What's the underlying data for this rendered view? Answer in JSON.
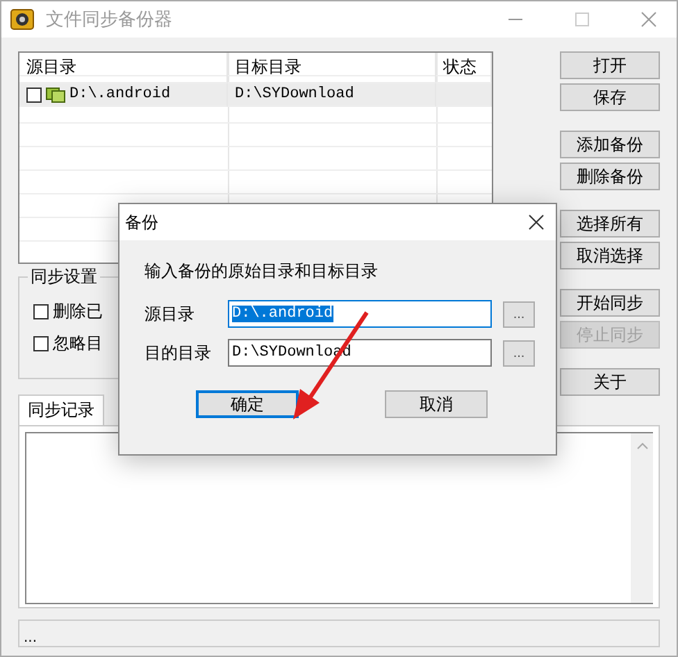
{
  "window": {
    "title": "文件同步备份器"
  },
  "list": {
    "columns": [
      "源目录",
      "目标目录",
      "状态"
    ],
    "rows": [
      {
        "checked": false,
        "selected": true,
        "cells": [
          "D:\\.android",
          "D:\\SYDownload",
          ""
        ]
      }
    ]
  },
  "button_groups": [
    [
      {
        "label": "打开",
        "disabled": false
      },
      {
        "label": "保存",
        "disabled": false
      }
    ],
    [
      {
        "label": "添加备份",
        "disabled": false
      },
      {
        "label": "删除备份",
        "disabled": false
      }
    ],
    [
      {
        "label": "选择所有",
        "disabled": false
      },
      {
        "label": "取消选择",
        "disabled": false
      }
    ],
    [
      {
        "label": "开始同步",
        "disabled": false
      },
      {
        "label": "停止同步",
        "disabled": true
      }
    ],
    [
      {
        "label": "关于",
        "disabled": false
      }
    ]
  ],
  "sync_settings": {
    "title": "同步设置",
    "options": [
      {
        "label": "删除已",
        "checked": false
      },
      {
        "label": "忽略目",
        "checked": false
      }
    ]
  },
  "tabs": [
    {
      "label": "同步记录",
      "selected": true
    }
  ],
  "status_bar": {
    "text": "..."
  },
  "dialog": {
    "title": "备份",
    "prompt": "输入备份的原始目录和目标目录",
    "fields": [
      {
        "label": "源目录",
        "value": "D:\\.android",
        "text_selected": true,
        "browse": "..."
      },
      {
        "label": "目的目录",
        "value": "D:\\SYDownload",
        "text_selected": false,
        "browse": "..."
      }
    ],
    "buttons": [
      {
        "label": "确定",
        "default": true
      },
      {
        "label": "取消",
        "default": false
      }
    ]
  }
}
